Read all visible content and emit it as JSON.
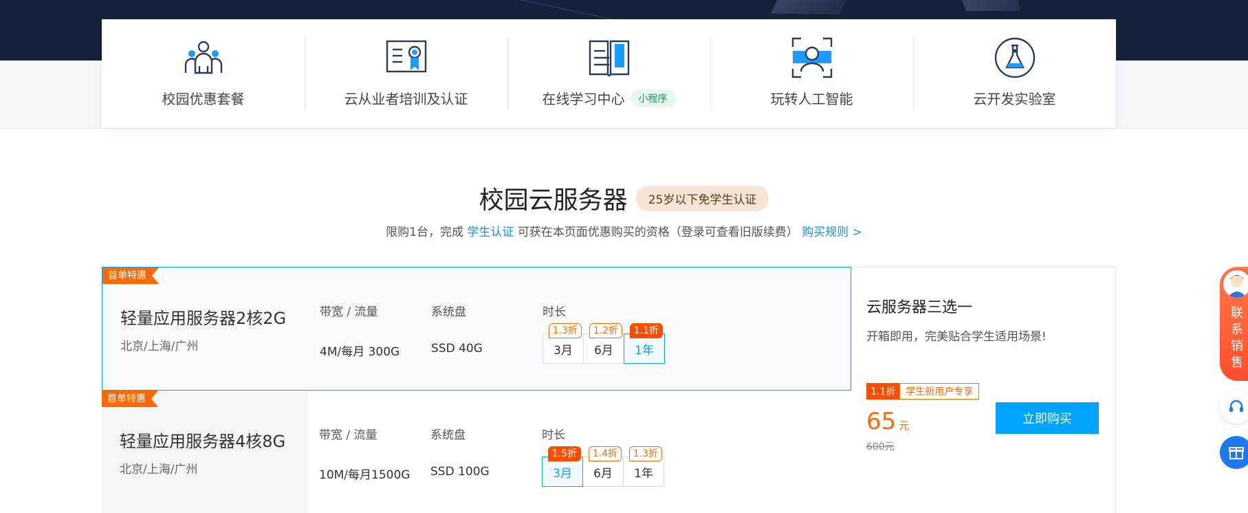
{
  "nav": [
    {
      "label": "校园优惠套餐",
      "icon": "people-group-icon"
    },
    {
      "label": "云从业者培训及认证",
      "icon": "certificate-icon"
    },
    {
      "label": "在线学习中心",
      "icon": "open-book-icon",
      "badge": "小程序"
    },
    {
      "label": "玩转人工智能",
      "icon": "face-scan-icon"
    },
    {
      "label": "云开发实验室",
      "icon": "flask-icon"
    }
  ],
  "section": {
    "title": "校园云服务器",
    "tag": "25岁以下免学生认证",
    "sub_prefix": "限购1台，完成",
    "sub_link": "学生认证",
    "sub_middle": "可获在本页面优惠购买的资格（登录可查看旧版续费）",
    "rules_link": "购买规则 >"
  },
  "columns": {
    "bandwidth": "带宽 / 流量",
    "disk": "系统盘",
    "duration": "时长"
  },
  "products": [
    {
      "ribbon": "首单特惠",
      "name": "轻量应用服务器2核2G",
      "region": "北京/上海/广州",
      "bandwidth": "4M/每月 300G",
      "disk": "SSD 40G",
      "durations": [
        {
          "label": "3月",
          "discount": "1.3折",
          "selected": false,
          "hot": false
        },
        {
          "label": "6月",
          "discount": "1.2折",
          "selected": false,
          "hot": false
        },
        {
          "label": "1年",
          "discount": "1.1折",
          "selected": true,
          "hot": true
        }
      ]
    },
    {
      "ribbon": "首单特惠",
      "name": "轻量应用服务器4核8G",
      "region": "北京/上海/广州",
      "bandwidth": "10M/每月1500G",
      "disk": "SSD 100G",
      "durations": [
        {
          "label": "3月",
          "discount": "1.5折",
          "selected": true,
          "hot": true
        },
        {
          "label": "6月",
          "discount": "1.4折",
          "selected": false,
          "hot": false
        },
        {
          "label": "1年",
          "discount": "1.3折",
          "selected": false,
          "hot": false
        }
      ]
    }
  ],
  "side": {
    "title": "云服务器三选一",
    "desc": "开箱即用，完美贴合学生适用场景!",
    "promo_discount": "1.1折",
    "promo_label": "学生新用户专享",
    "price": "65",
    "price_unit": "元",
    "original": "600元",
    "buy": "立即购买"
  },
  "float": {
    "sales": "联系销售"
  },
  "colors": {
    "accent": "#00a4ff",
    "discount": "#ff6a00",
    "dark_banner": "#15213a"
  }
}
